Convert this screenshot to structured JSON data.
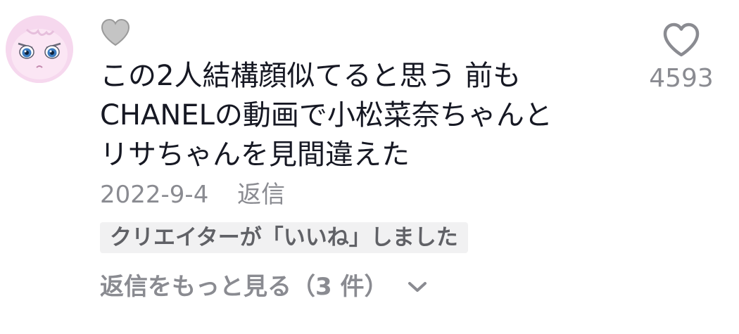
{
  "comment": {
    "text": "この2人結構顔似てると思う 前も\nCHANELの動画で小松菜奈ちゃんと\nリサちゃんを見間違えた",
    "date": "2022-9-4",
    "reply_label": "返信",
    "creator_liked_label": "クリエイターが「いいね」しました",
    "more_replies_label": "返信をもっと見る（3 件）",
    "like_count": "4593",
    "icons": {
      "avatar": "avatar",
      "creator_heart": "heart-filled-icon",
      "like": "heart-outline-icon",
      "expand": "chevron-down-icon"
    },
    "colors": {
      "text": "#161823",
      "muted": "#8a8b91",
      "badge_bg": "#f1f1f2",
      "creator_heart": "#c4c4c4"
    }
  }
}
